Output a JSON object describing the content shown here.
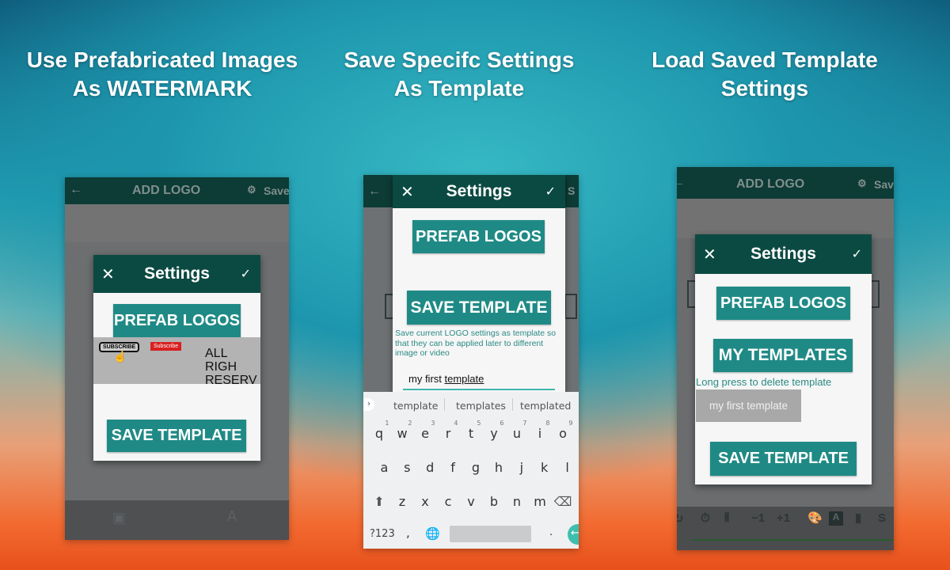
{
  "captions": [
    {
      "line1": "Use Prefabricated Images",
      "line2": "As WATERMARK"
    },
    {
      "line1": "Save Specifc Settings",
      "line2": "As Template"
    },
    {
      "line1": "Load Saved Template",
      "line2": "Settings"
    }
  ],
  "app": {
    "title": "ADD LOGO",
    "save": "Save",
    "back_icon": "arrow-left-icon",
    "gear_icon": "gear-icon"
  },
  "dialog": {
    "title": "Settings",
    "close": "✕",
    "confirm": "✓",
    "prefab_logos": "PREFAB LOGOS",
    "save_template": "SAVE TEMPLATE",
    "my_templates": "MY TEMPLATES"
  },
  "prefab_strip": {
    "subscribe_outline": "SUBSCRIBE",
    "subscribe_red": "Subscribe",
    "rights_line1": "ALL RIGH",
    "rights_line2": "RESERV"
  },
  "save_screen": {
    "description": "Save current LOGO settings as template so that they can be applied later to different image or video",
    "input_value_prefix": "my first ",
    "input_value_word": "template"
  },
  "keyboard": {
    "suggestions": [
      "template",
      "templates",
      "templated"
    ],
    "row1": [
      "q",
      "w",
      "e",
      "r",
      "t",
      "y",
      "u",
      "i",
      "o"
    ],
    "row1_nums": [
      "1",
      "2",
      "3",
      "4",
      "5",
      "6",
      "7",
      "8",
      "9"
    ],
    "row2": [
      "a",
      "s",
      "d",
      "f",
      "g",
      "h",
      "j",
      "k",
      "l"
    ],
    "row3": [
      "z",
      "x",
      "c",
      "v",
      "b",
      "n",
      "m"
    ],
    "sym": "?123",
    "comma": ",",
    "period": "."
  },
  "load_screen": {
    "hint": "Long press to delete template",
    "templates": [
      "my first template"
    ]
  },
  "toolbar": {
    "minus": "−1",
    "plus": "+1",
    "s": "S",
    "a": "A"
  },
  "colors": {
    "teal_button": "#1f8a85",
    "dialog_header": "#0b4a42",
    "hint_text": "#2a8a84"
  }
}
